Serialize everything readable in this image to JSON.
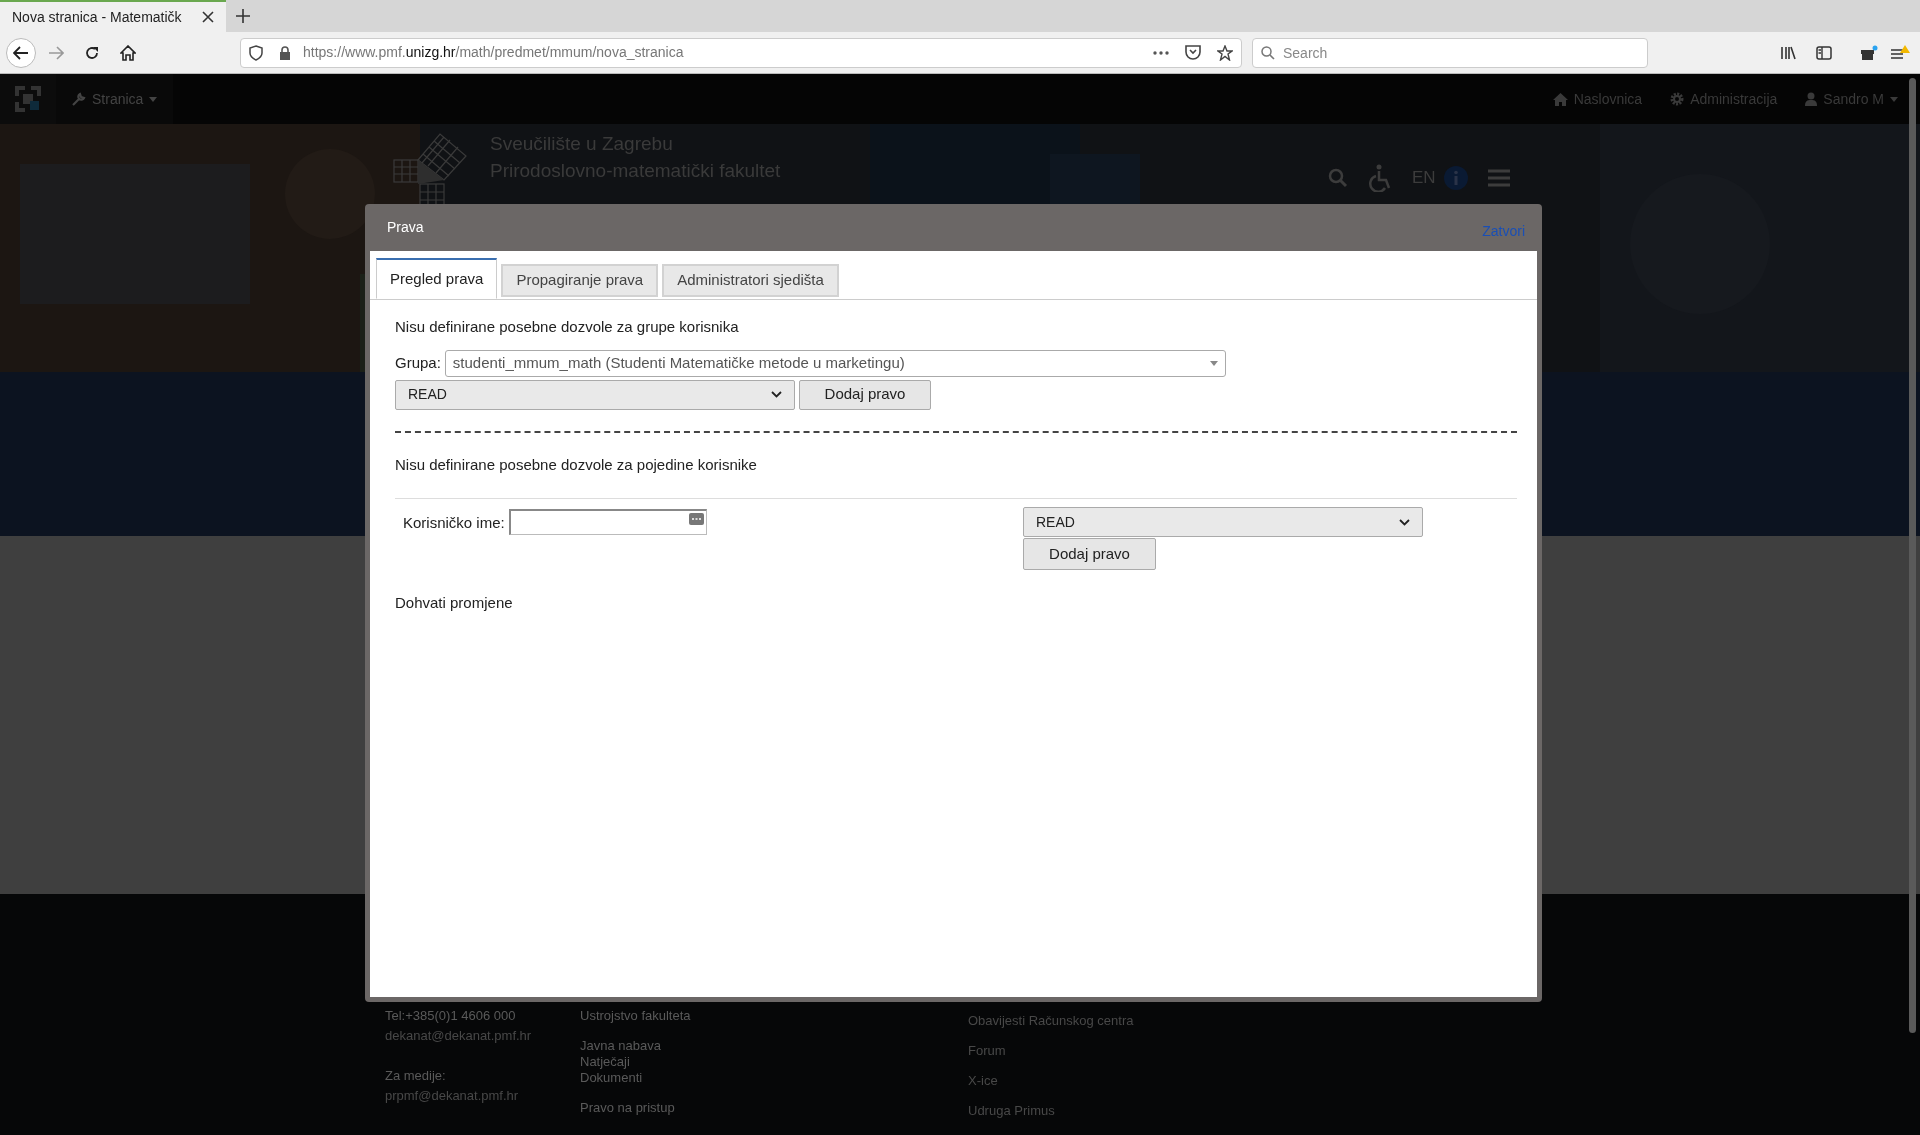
{
  "browser": {
    "tab_title": "Nova stranica - Matematičk",
    "url": {
      "scheme_host": "https://www.pmf.",
      "domain": "unizg.hr",
      "path": "/math/predmet/mmum/nova_stranica"
    },
    "search": {
      "placeholder": "Search"
    }
  },
  "site_nav": {
    "menu": "Stranica",
    "right_items": [
      {
        "kind": "home",
        "label": "Naslovnica"
      },
      {
        "kind": "gear",
        "label": "Administracija"
      },
      {
        "kind": "user",
        "label": "Sandro M"
      }
    ]
  },
  "header": {
    "lines": [
      "Sveučilište u Zagrebu",
      "Prirodoslovno-matematički fakultet"
    ],
    "language": "EN"
  },
  "modal": {
    "title": "Prava",
    "close": "Zatvori",
    "tabs": [
      {
        "label": "Pregled prava",
        "selected": true
      },
      {
        "label": "Propagiranje prava",
        "selected": false
      },
      {
        "label": "Administratori sjedišta",
        "selected": false
      }
    ],
    "groups": {
      "message": "Nisu definirane posebne dozvole za grupe korisnika",
      "group_label": "Grupa:",
      "group_value": "studenti_mmum_math (Studenti Matematičke metode u marketingu)",
      "permission": "READ",
      "button": "Dodaj pravo"
    },
    "users": {
      "message": "Nisu definirane posebne dozvole za pojedine korisnike",
      "username_label": "Korisničko ime:",
      "permission": "READ",
      "button": "Dodaj pravo"
    },
    "changes_link": "Dohvati promjene"
  },
  "footer": {
    "columns": [
      [
        {
          "kind": "strong",
          "text": "Tel:+385(0)1 4606 000"
        },
        {
          "kind": "dim",
          "text": "dekanat@dekanat.pmf.hr"
        },
        {
          "kind": "strong",
          "text": "Za medije:"
        },
        {
          "kind": "dim",
          "text": "prpmf@dekanat.pmf.hr"
        }
      ],
      [
        {
          "kind": "strong",
          "text": "Ustrojstvo fakulteta"
        },
        {
          "kind": "strong",
          "text": "Javna nabava"
        },
        {
          "kind": "strong",
          "text": "Natječaji"
        },
        {
          "kind": "strong",
          "text": "Dokumenti"
        },
        {
          "kind": "strong",
          "text": "Pravo na pristup"
        }
      ],
      [
        {
          "kind": "dim",
          "text": "Obavijesti Računskog centra"
        },
        {
          "kind": "dim",
          "text": "Forum"
        },
        {
          "kind": "dim",
          "text": "X-ice"
        },
        {
          "kind": "dim",
          "text": "Udruga Primus"
        }
      ]
    ]
  }
}
